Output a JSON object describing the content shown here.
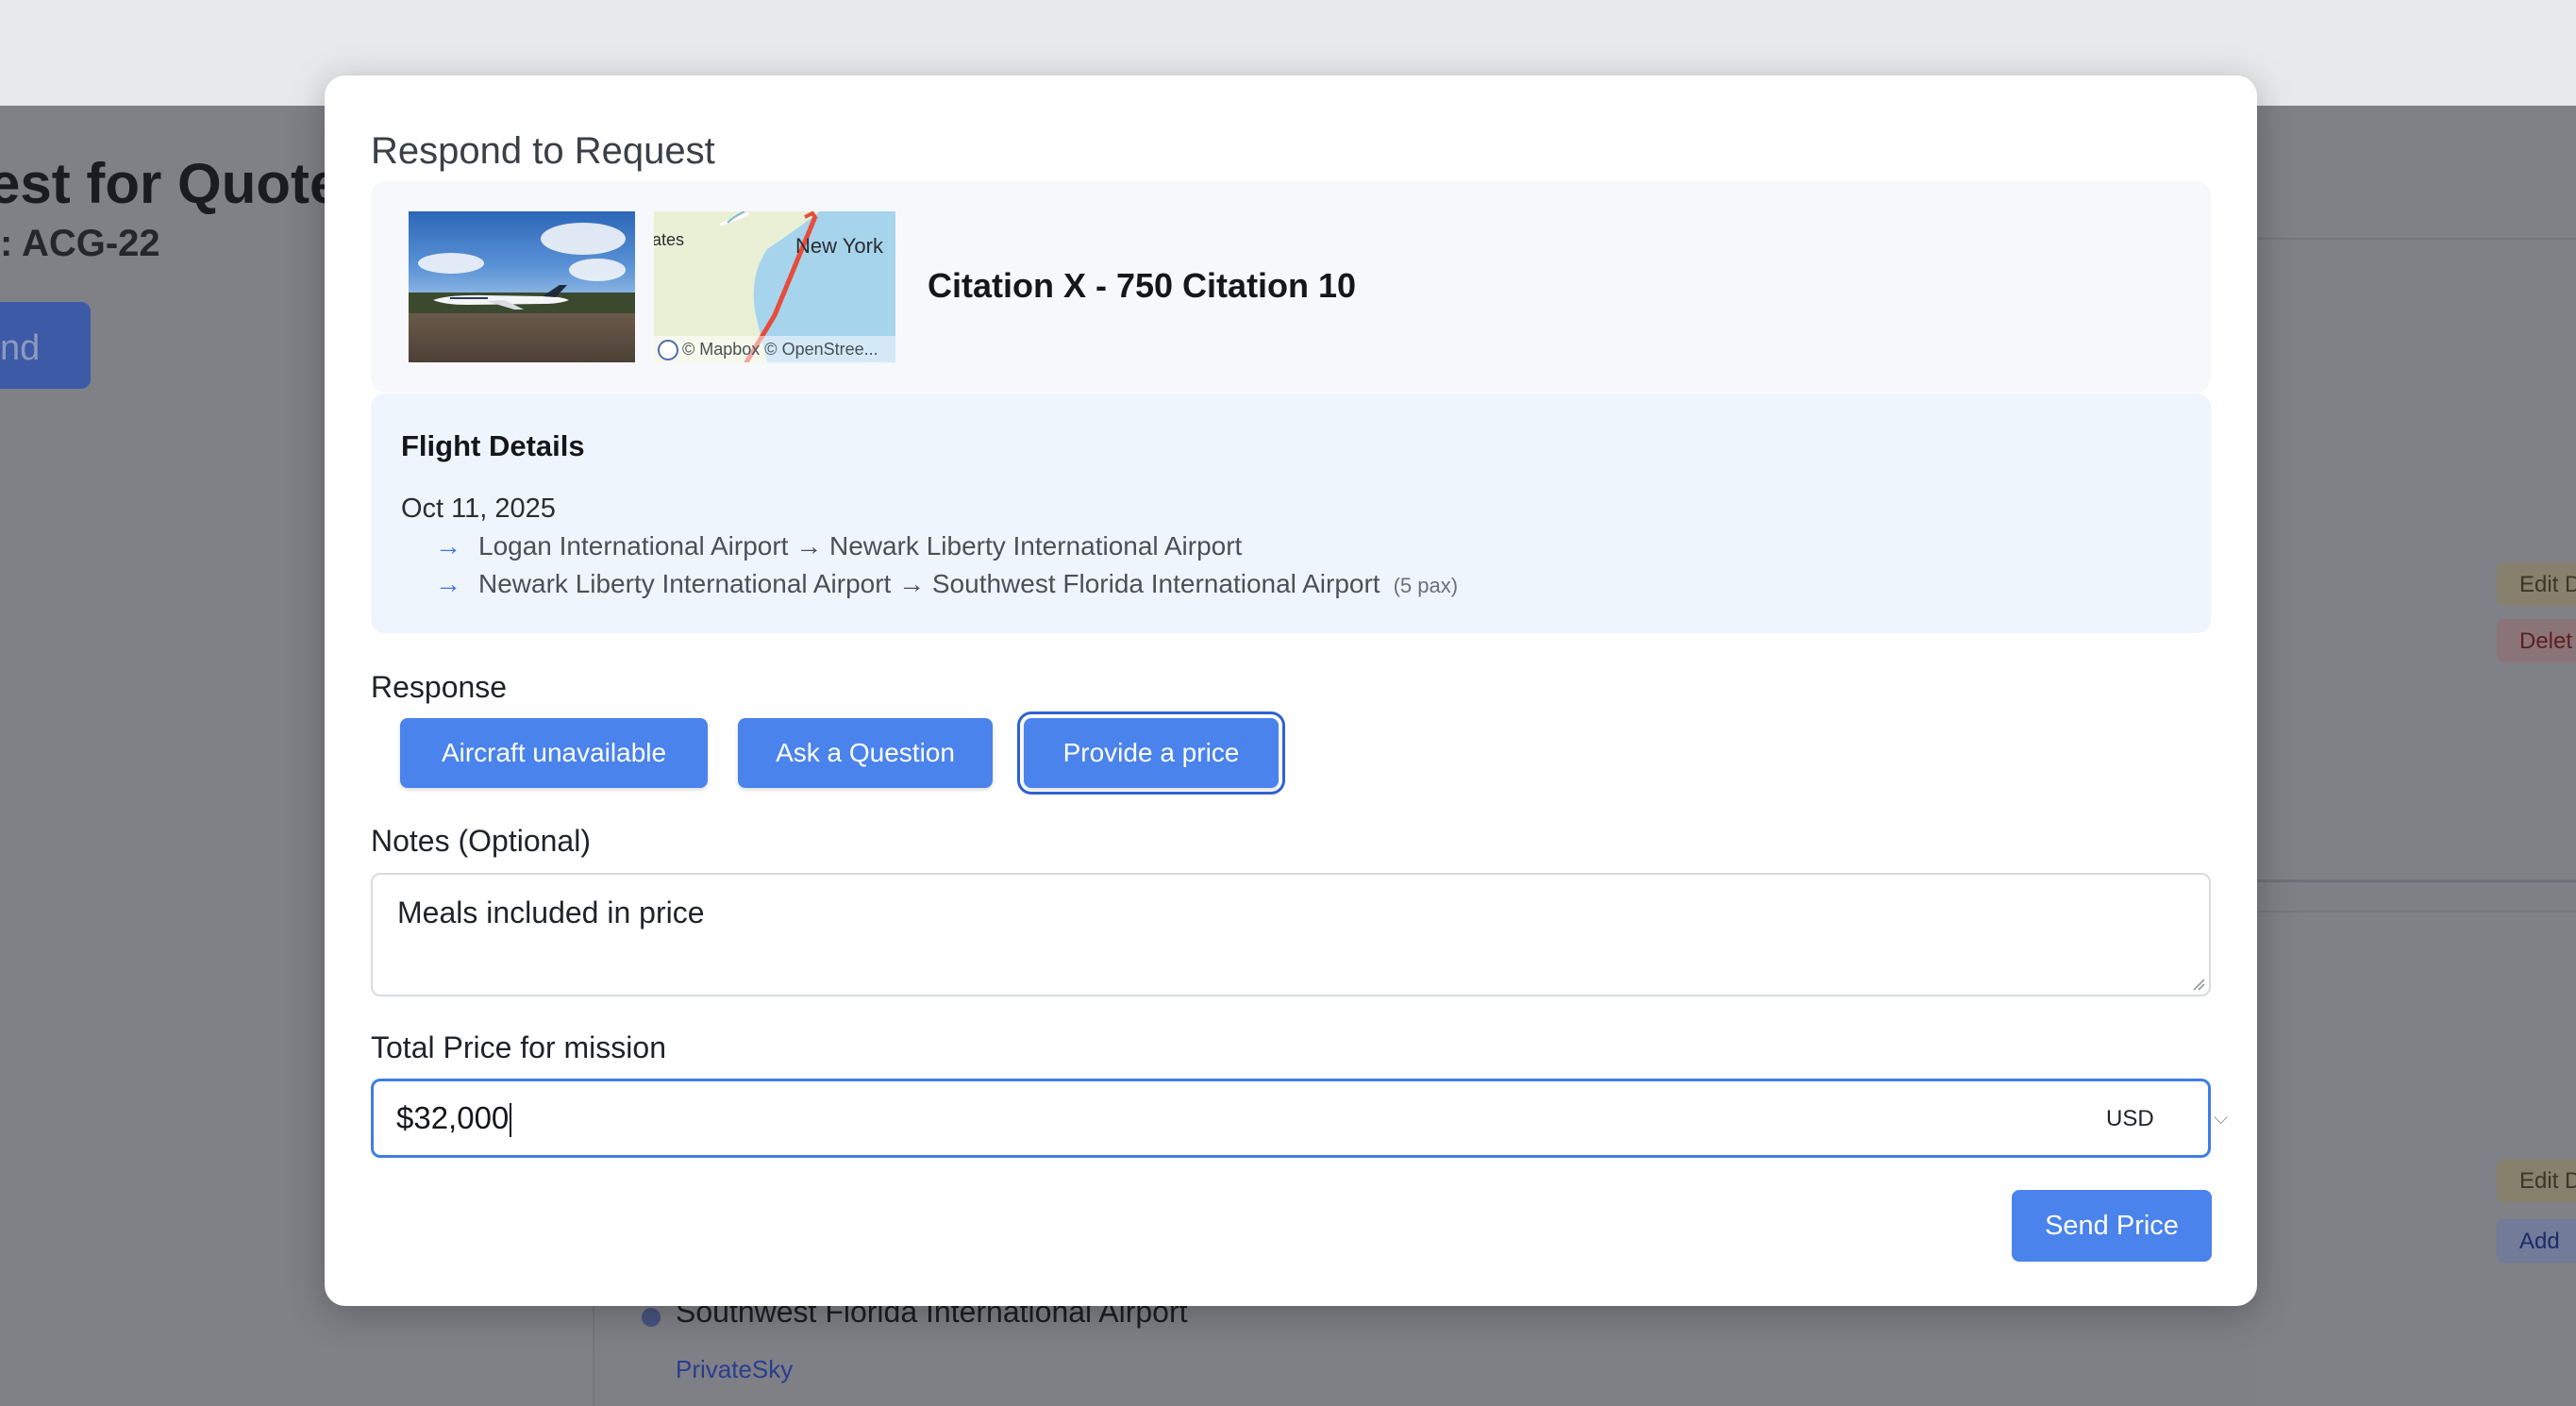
{
  "background": {
    "page_title": "est for Quote",
    "page_subtitle": ": ACG-22",
    "action_button": "nd",
    "pills": {
      "edit_1": "Edit D",
      "delete_1": "Delet",
      "edit_2": "Edit D",
      "add_2": "Add"
    },
    "airport": "Southwest Florida International Airport",
    "operator_link": "PrivateSky"
  },
  "modal": {
    "title": "Respond to Request",
    "aircraft": {
      "name": "Citation X - 750 Citation 10",
      "photo_icon": "aircraft-photo",
      "map": {
        "label_states": "ates",
        "label_city": "New York",
        "attribution": "© Mapbox © OpenStree..."
      }
    },
    "flight_details": {
      "title": "Flight Details",
      "date": "Oct 11, 2025",
      "legs": [
        {
          "route": "Logan International Airport → Newark Liberty International Airport",
          "pax": ""
        },
        {
          "route": "Newark Liberty International Airport → Southwest Florida International Airport",
          "pax": "(5 pax)"
        }
      ]
    },
    "response": {
      "label": "Response",
      "options": [
        "Aircraft unavailable",
        "Ask a Question",
        "Provide a price"
      ],
      "selected": "Provide a price"
    },
    "notes": {
      "label": "Notes (Optional)",
      "value": "Meals included in price"
    },
    "price": {
      "label": "Total Price for mission",
      "value": "$32,000",
      "currency": "USD"
    },
    "send_button": "Send Price"
  },
  "colors": {
    "accent": "#4a83ec",
    "flight_card_bg": "#eff5fd",
    "route_line": "#e74c3c"
  }
}
